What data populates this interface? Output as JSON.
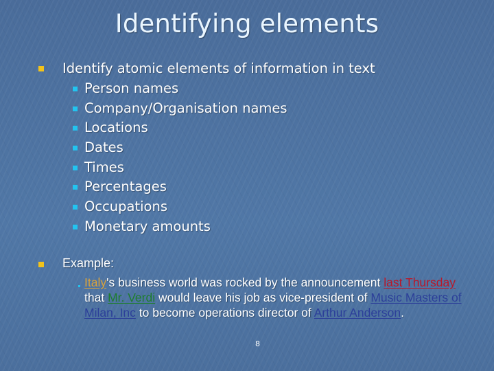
{
  "slide": {
    "title": "Identifying elements",
    "page_number": "8",
    "bullets": [
      {
        "text": "Identify atomic elements of information in text",
        "sub_items": [
          "Person names",
          "Company/Organisation names",
          "Locations",
          "Dates",
          "Times",
          "Percentages",
          "Occupations",
          "Monetary amounts"
        ]
      },
      {
        "text": "Example:"
      }
    ],
    "example": {
      "segments": [
        {
          "text": "Italy",
          "entity": "location",
          "color": "#d9a23c"
        },
        {
          "text": "'s business world was rocked by the announcement "
        },
        {
          "text": "last Thursday",
          "entity": "date",
          "color": "#b8182a"
        },
        {
          "text": " that "
        },
        {
          "text": "Mr. Verdi",
          "entity": "person",
          "color": "#1e7d2e"
        },
        {
          "text": " would leave his job as vice-president of "
        },
        {
          "text": "Music Masters of Milan, Inc",
          "entity": "organisation",
          "color": "#2c3f99"
        },
        {
          "text": " to become operations director of "
        },
        {
          "text": "Arthur Anderson",
          "entity": "organisation",
          "color": "#2c3f99"
        },
        {
          "text": "."
        }
      ]
    },
    "colors": {
      "background": "#4b6e9c",
      "level1_bullet": "#f3c31a",
      "level2_bullet": "#22c4f0",
      "title_text": "#eaf6ff"
    }
  }
}
